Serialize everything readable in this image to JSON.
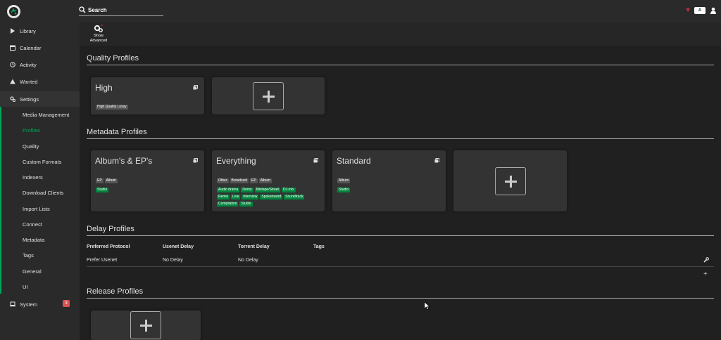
{
  "header": {
    "search_label": "Search",
    "keyboard_label": "A"
  },
  "sidebar": {
    "items": [
      {
        "label": "Library",
        "icon": "play-icon"
      },
      {
        "label": "Calendar",
        "icon": "calendar-icon"
      },
      {
        "label": "Activity",
        "icon": "clock-icon"
      },
      {
        "label": "Wanted",
        "icon": "warning-icon"
      },
      {
        "label": "Settings",
        "icon": "gears-icon"
      },
      {
        "label": "System",
        "icon": "laptop-icon",
        "badge": "3"
      }
    ],
    "settings_items": [
      "Media Management",
      "Profiles",
      "Quality",
      "Custom Formats",
      "Indexers",
      "Download Clients",
      "Import Lists",
      "Connect",
      "Metadata",
      "Tags",
      "General",
      "UI"
    ],
    "active_settings_item": "Profiles"
  },
  "toolbar": {
    "show_advanced_line1": "Show",
    "show_advanced_line2": "Advanced"
  },
  "quality_profiles": {
    "title": "Quality Profiles",
    "cards": [
      {
        "name": "High",
        "tags": [
          "High Quality Lossy"
        ]
      }
    ]
  },
  "metadata_profiles": {
    "title": "Metadata Profiles",
    "cards": [
      {
        "name": "Album's & EP's",
        "gray_tags": [
          "EP",
          "Album"
        ],
        "green_tags": [
          "Studio"
        ]
      },
      {
        "name": "Everything",
        "gray_tags": [
          "Other",
          "Broadcast",
          "EP",
          "Album"
        ],
        "green_tags": [
          "Audio drama",
          "Demo",
          "Mixtape/Street",
          "DJ-mix",
          "Remix",
          "Live",
          "Interview",
          "Spokenword",
          "Soundtrack",
          "Compilation",
          "Studio"
        ]
      },
      {
        "name": "Standard",
        "gray_tags": [
          "Album"
        ],
        "green_tags": [
          "Studio"
        ]
      }
    ]
  },
  "delay_profiles": {
    "title": "Delay Profiles",
    "columns": [
      "Preferred Protocol",
      "Usenet Delay",
      "Torrent Delay",
      "Tags"
    ],
    "rows": [
      {
        "protocol": "Prefer Usenet",
        "usenet_delay": "No Delay",
        "torrent_delay": "No Delay",
        "tags": ""
      }
    ],
    "add_symbol": "+"
  },
  "release_profiles": {
    "title": "Release Profiles"
  },
  "colors": {
    "accent_green": "#00a65b",
    "tag_green": "#00853d",
    "badge_red": "#d9534f",
    "heart_red": "#c0303a"
  }
}
